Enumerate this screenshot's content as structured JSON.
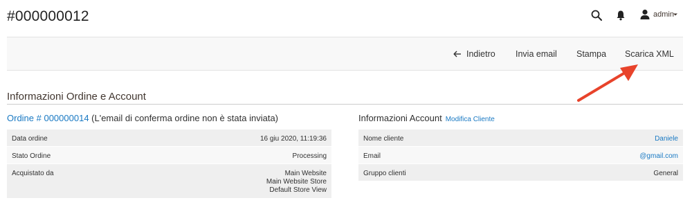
{
  "page": {
    "title": "#000000012"
  },
  "header": {
    "search_icon": "search-icon",
    "bell_icon": "bell-icon",
    "user_icon": "user-icon",
    "admin_label": "admin"
  },
  "toolbar": {
    "back_label": "Indietro",
    "email_label": "Invia email",
    "print_label": "Stampa",
    "xml_label": "Scarica XML"
  },
  "section": {
    "title": "Informazioni Ordine e Account"
  },
  "order": {
    "link_text": "Ordine # 000000014",
    "note": " (L'email di conferma ordine non è stata inviata)",
    "rows": [
      {
        "label": "Data ordine",
        "value": "16 giu 2020, 11:19:36"
      },
      {
        "label": "Stato Ordine",
        "value": "Processing"
      },
      {
        "label": "Acquistato da",
        "values": [
          "Main Website",
          "Main Website Store",
          "Default Store View"
        ]
      }
    ]
  },
  "account": {
    "title": "Informazioni Account",
    "edit_link": "Modifica Cliente",
    "rows": [
      {
        "label": "Nome cliente",
        "value": "Daniele"
      },
      {
        "label": "Email",
        "value": "@gmail.com"
      },
      {
        "label": "Gruppo clienti",
        "value": "General"
      }
    ]
  },
  "colors": {
    "link": "#1979c3",
    "annotation_arrow": "#e8432b",
    "toolbar_bg": "#f8f8f8"
  }
}
